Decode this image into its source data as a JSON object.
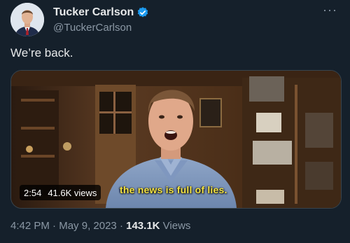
{
  "author": {
    "display_name": "Tucker Carlson",
    "handle": "@TuckerCarlson",
    "verified": true
  },
  "header": {
    "more_label": "···"
  },
  "tweet": {
    "text": "We’re back."
  },
  "media": {
    "duration": "2:54",
    "views": "41.6K views",
    "caption": "the news is full of lies."
  },
  "meta": {
    "time": "4:42 PM",
    "separator1": " · ",
    "date": "May 9, 2023",
    "separator2": " · ",
    "views_count": "143.1K",
    "views_label": " Views"
  },
  "colors": {
    "background": "#15202b",
    "verified_badge": "#1d9bf0",
    "caption": "#f5e342",
    "secondary_text": "#8b98a5"
  }
}
